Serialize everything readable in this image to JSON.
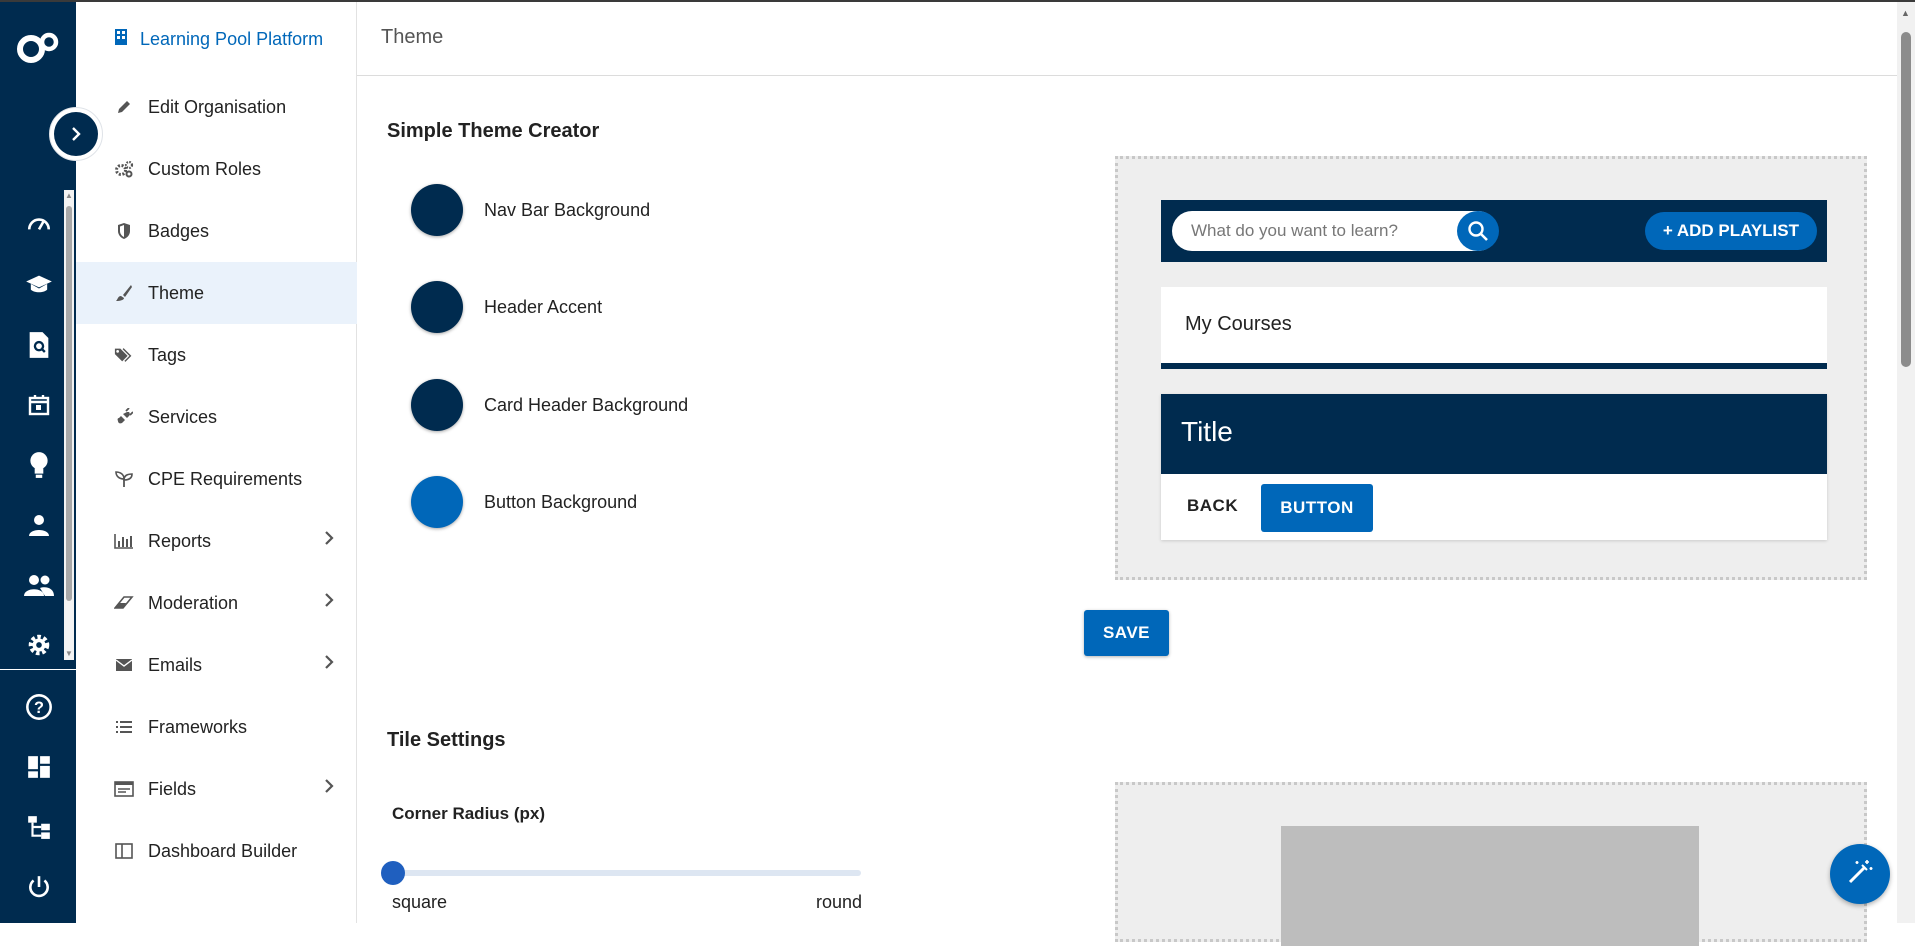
{
  "colors": {
    "rail": "#002b4f",
    "brand": "#0067b9",
    "nav_bar_background": "#002b4f",
    "header_accent": "#002b4f",
    "card_header_background": "#002b4f",
    "button_background": "#0067b9",
    "active_item": "#eaf2fb"
  },
  "rail": {
    "icons": [
      "dashboard-gauge-icon",
      "graduation-cap-icon",
      "document-search-icon",
      "calendar-icon",
      "lightbulb-icon",
      "person-icon",
      "people-icon",
      "gear-icon",
      "help-icon",
      "dashboard-tiles-icon",
      "hierarchy-icon",
      "power-icon"
    ]
  },
  "sidebar": {
    "title": "Learning Pool Platform",
    "items": [
      {
        "label": "Edit Organisation",
        "icon": "pencil-icon",
        "submenu": false,
        "active": false
      },
      {
        "label": "Custom Roles",
        "icon": "gears-icon",
        "submenu": false,
        "active": false
      },
      {
        "label": "Badges",
        "icon": "shield-icon",
        "submenu": false,
        "active": false
      },
      {
        "label": "Theme",
        "icon": "paintbrush-icon",
        "submenu": false,
        "active": true
      },
      {
        "label": "Tags",
        "icon": "tags-icon",
        "submenu": false,
        "active": false
      },
      {
        "label": "Services",
        "icon": "plug-icon",
        "submenu": false,
        "active": false
      },
      {
        "label": "CPE Requirements",
        "icon": "seedling-icon",
        "submenu": false,
        "active": false
      },
      {
        "label": "Reports",
        "icon": "bar-chart-icon",
        "submenu": true,
        "active": false
      },
      {
        "label": "Moderation",
        "icon": "eraser-icon",
        "submenu": true,
        "active": false
      },
      {
        "label": "Emails",
        "icon": "envelope-icon",
        "submenu": true,
        "active": false
      },
      {
        "label": "Frameworks",
        "icon": "list-icon",
        "submenu": false,
        "active": false
      },
      {
        "label": "Fields",
        "icon": "form-icon",
        "submenu": true,
        "active": false
      },
      {
        "label": "Dashboard Builder",
        "icon": "layout-icon",
        "submenu": false,
        "active": false
      }
    ]
  },
  "header": {
    "title": "Theme"
  },
  "theme_creator": {
    "heading": "Simple Theme Creator",
    "swatches": [
      {
        "label": "Nav Bar Background",
        "color": "#002b4f"
      },
      {
        "label": "Header Accent",
        "color": "#002b4f"
      },
      {
        "label": "Card Header Background",
        "color": "#002b4f"
      },
      {
        "label": "Button Background",
        "color": "#0067b9"
      }
    ],
    "preview": {
      "search_placeholder": "What do you want to learn?",
      "add_playlist": "+ ADD PLAYLIST",
      "my_courses": "My Courses",
      "card_title": "Title",
      "back_label": "BACK",
      "button_label": "BUTTON"
    },
    "save_label": "SAVE"
  },
  "tile_settings": {
    "heading": "Tile Settings",
    "corner_radius_label": "Corner Radius (px)",
    "min_label": "square",
    "max_label": "round",
    "slider_value_fraction": 0
  }
}
